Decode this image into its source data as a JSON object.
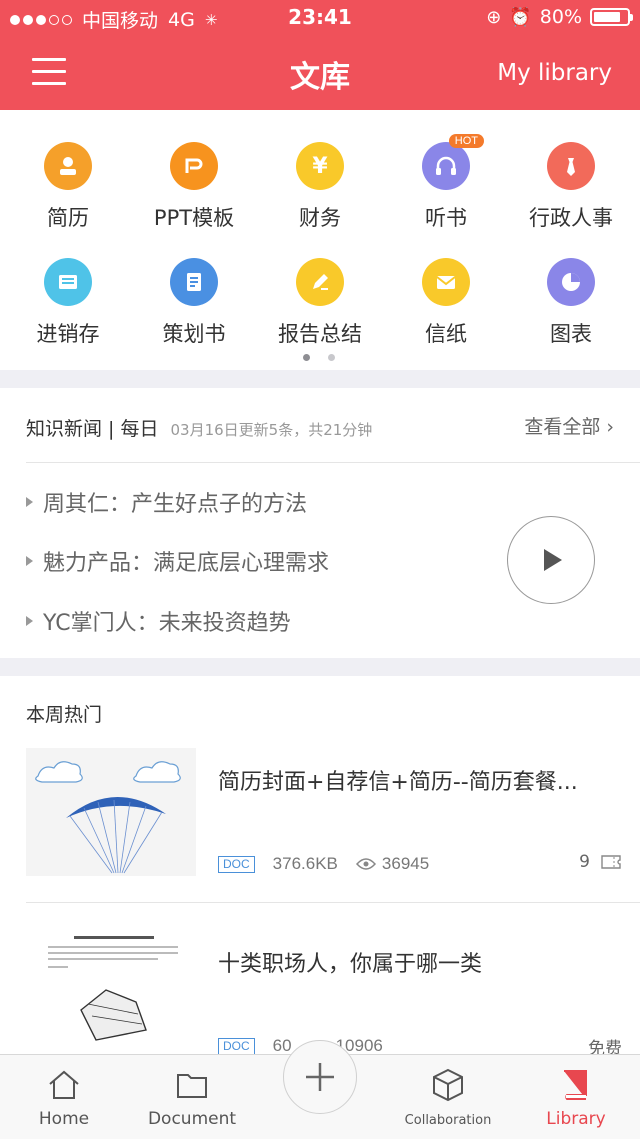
{
  "status_bar": {
    "carrier": "中国移动",
    "network": "4G",
    "time": "23:41",
    "battery_percent": "80%",
    "battery_level": 0.8
  },
  "header": {
    "title": "文库",
    "right_link": "My library"
  },
  "categories": [
    {
      "label": "简历",
      "icon": "person-icon",
      "color": "#f5a02a"
    },
    {
      "label": "PPT模板",
      "icon": "ppt-icon",
      "color": "#f7931e"
    },
    {
      "label": "财务",
      "icon": "yen-icon",
      "color": "#f9c92a"
    },
    {
      "label": "听书",
      "icon": "headphones-icon",
      "color": "#8a86e8",
      "badge": "HOT"
    },
    {
      "label": "行政人事",
      "icon": "tie-icon",
      "color": "#f26a5a"
    },
    {
      "label": "进销存",
      "icon": "ledger-icon",
      "color": "#4fc3e8"
    },
    {
      "label": "策划书",
      "icon": "document-icon",
      "color": "#4a90e2"
    },
    {
      "label": "报告总结",
      "icon": "edit-icon",
      "color": "#f9c92a"
    },
    {
      "label": "信纸",
      "icon": "envelope-icon",
      "color": "#f9c92a"
    },
    {
      "label": "图表",
      "icon": "pie-chart-icon",
      "color": "#8a86e8"
    }
  ],
  "pager": {
    "pages": 2,
    "current": 1
  },
  "news": {
    "title": "知识新闻 | 每日",
    "subtitle": "03月16日更新5条，共21分钟",
    "view_all": "查看全部",
    "items": [
      "周其仁：产生好点子的方法",
      "魅力产品：满足底层心理需求",
      "YC掌门人：未来投资趋势"
    ]
  },
  "weekly_hot": {
    "title": "本周热门",
    "docs": [
      {
        "title": "简历封面+自荐信+简历--简历套餐...",
        "type": "DOC",
        "size": "376.6KB",
        "views": "36945",
        "right": "9"
      },
      {
        "title": "十类职场人，你属于哪一类",
        "type": "DOC",
        "size": "60",
        "views": "10906",
        "right": "免费"
      }
    ]
  },
  "tabbar": {
    "home": "Home",
    "document": "Document",
    "collaboration": "Collaboration",
    "library": "Library"
  },
  "colors": {
    "brand": "#f0515a",
    "active_tab": "#e8474f",
    "doc_tag": "#4a90d9"
  }
}
